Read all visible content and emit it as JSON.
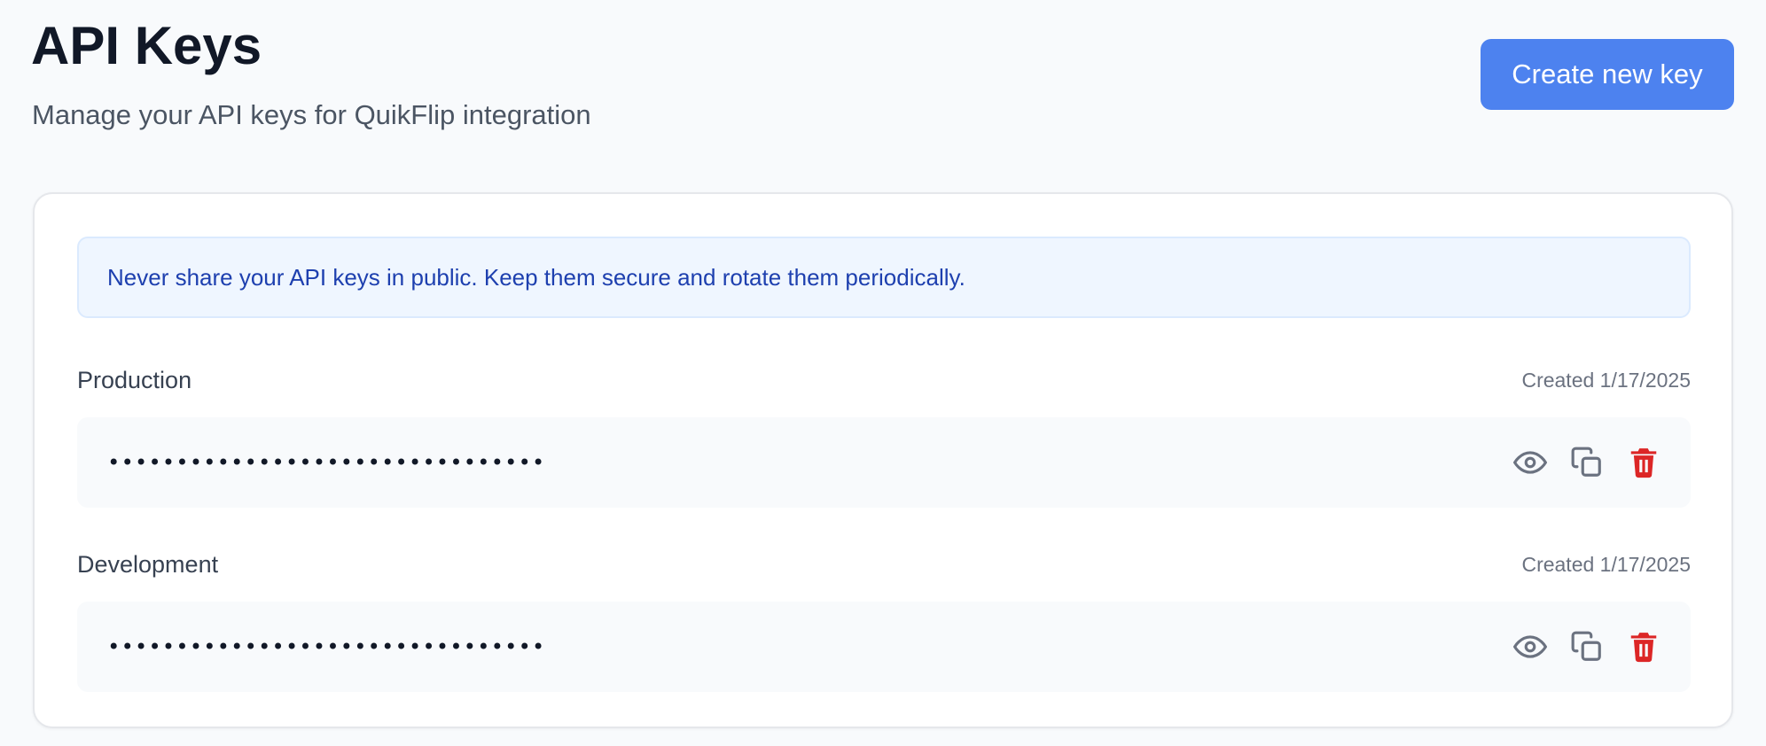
{
  "header": {
    "title": "API Keys",
    "subtitle": "Manage your API keys for QuikFlip integration",
    "create_button_label": "Create new key"
  },
  "notice": {
    "text": "Never share your API keys in public. Keep them secure and rotate them periodically."
  },
  "keys": [
    {
      "name": "Production",
      "created": "Created 1/17/2025",
      "masked_value": "••••••••••••••••••••••••••••••••"
    },
    {
      "name": "Development",
      "created": "Created 1/17/2025",
      "masked_value": "••••••••••••••••••••••••••••••••"
    }
  ],
  "icons": {
    "reveal": "eye-icon",
    "copy": "copy-icon",
    "delete": "trash-icon"
  },
  "colors": {
    "accent": "#4d82ef",
    "danger": "#dc2626",
    "notice_bg": "#eff6ff",
    "notice_text": "#1e40af"
  }
}
